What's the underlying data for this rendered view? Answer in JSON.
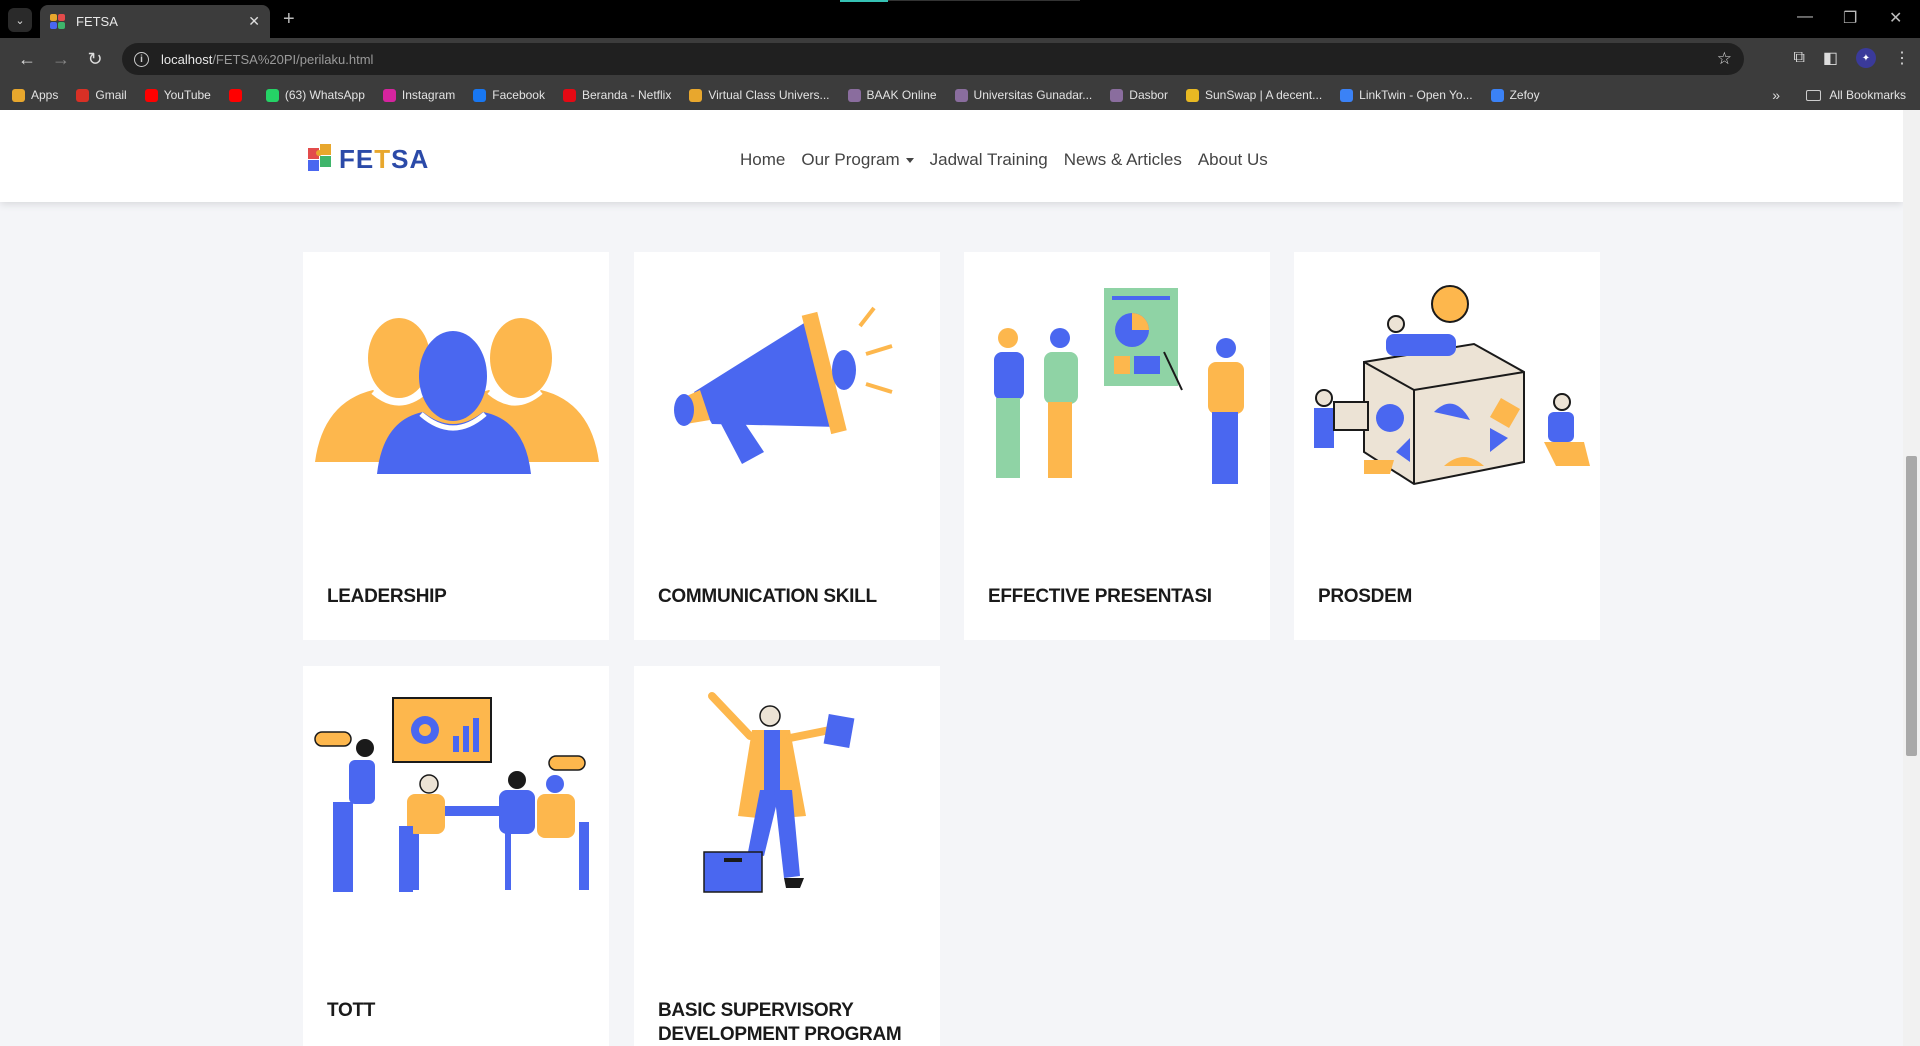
{
  "browser": {
    "tab_title": "FETSA",
    "url_host": "localhost",
    "url_path": "/FETSA%20PI/perilaku.html",
    "bookmarks": [
      {
        "label": "Apps",
        "color": "#e8a72d"
      },
      {
        "label": "Gmail",
        "color": "#d93025"
      },
      {
        "label": "YouTube",
        "color": "#ff0000"
      },
      {
        "label": "",
        "color": "#ff0000"
      },
      {
        "label": "(63) WhatsApp",
        "color": "#25d366"
      },
      {
        "label": "Instagram",
        "color": "#d6249f"
      },
      {
        "label": "Facebook",
        "color": "#1877f2"
      },
      {
        "label": "Beranda - Netflix",
        "color": "#e50914"
      },
      {
        "label": "Virtual Class Univers...",
        "color": "#e8a72d"
      },
      {
        "label": "BAAK Online",
        "color": "#8a6d9e"
      },
      {
        "label": "Universitas Gunadar...",
        "color": "#8a6d9e"
      },
      {
        "label": "Dasbor",
        "color": "#8a6d9e"
      },
      {
        "label": "SunSwap | A decent...",
        "color": "#e8b923"
      },
      {
        "label": "LinkTwin - Open Yo...",
        "color": "#3b82f6"
      },
      {
        "label": "Zefoy",
        "color": "#3b82f6"
      }
    ],
    "all_bookmarks": "All Bookmarks"
  },
  "site": {
    "logo_text_a": "FE",
    "logo_text_b": "T",
    "logo_text_c": "SA",
    "nav": [
      "Home",
      "Our Program",
      "Jadwal Training",
      "News & Articles",
      "About Us"
    ]
  },
  "cards": [
    {
      "title": "LEADERSHIP",
      "icon": "people-group-icon"
    },
    {
      "title": "COMMUNICATION SKILL",
      "icon": "megaphone-icon"
    },
    {
      "title": "EFFECTIVE PRESENTASI",
      "icon": "presentation-icon"
    },
    {
      "title": "PROSDEM",
      "icon": "shape-cube-icon"
    },
    {
      "title": "TOTT",
      "icon": "team-meeting-icon"
    },
    {
      "title": "BASIC SUPERVISORY DEVELOPMENT PROGRAM",
      "icon": "supervisor-icon"
    }
  ],
  "colors": {
    "blue": "#4a67f0",
    "orange": "#fdb74d",
    "dark": "#1a1a1a"
  }
}
